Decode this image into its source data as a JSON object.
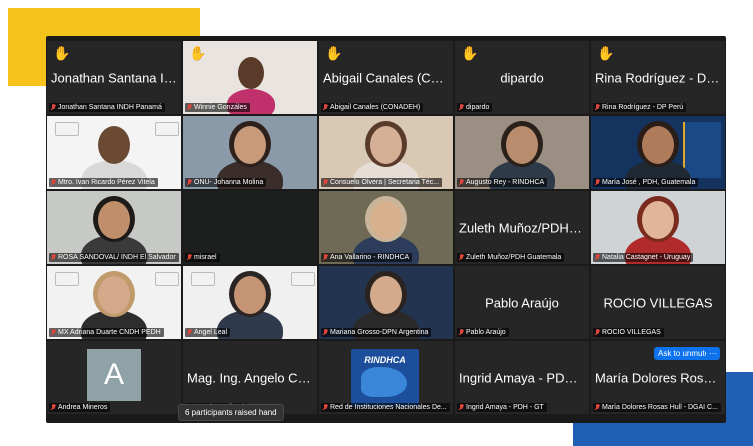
{
  "colors": {
    "accent_yellow": "#f6c21c",
    "accent_blue": "#1f5fb4",
    "tile_bg": "#262626",
    "active_outline": "#2ecc40",
    "mute_red": "#e0453a",
    "zoom_blue": "#0e72ed"
  },
  "tiles": [
    {
      "center": "Jonathan Santana IND...",
      "label": "Jonathan Santana INDH Panamá",
      "hand": true
    },
    {
      "center": "",
      "label": "Winnie Gonzáles",
      "hand": true,
      "active": true
    },
    {
      "center": "Abigail Canales (CON...",
      "label": "Abigail Canales (CONADEH)",
      "hand": true
    },
    {
      "center": "dipardo",
      "label": "dipardo",
      "hand": true
    },
    {
      "center": "Rina Rodríguez - DP P...",
      "label": "Rina Rodríguez - DP Perú",
      "hand": true
    },
    {
      "center": "",
      "label": "Mtro. Ivan Ricardo Pérez Vitela"
    },
    {
      "center": "",
      "label": "ONU- Johanna Molina"
    },
    {
      "center": "",
      "label": "Consuelo Olvera | Secretaria Téc..."
    },
    {
      "center": "",
      "label": "Augusto Rey - RINDHCA"
    },
    {
      "center": "",
      "label": "María José , PDH, Guatemala"
    },
    {
      "center": "",
      "label": "ROSA SANDOVAL/ INDH El Salvador"
    },
    {
      "center": "",
      "label": "misrael"
    },
    {
      "center": "",
      "label": "Ana Vallarino - RINDHCA"
    },
    {
      "center": "Zuleth Muñoz/PDH Gu...",
      "label": "Zuleth Muñoz/PDH Guatemala"
    },
    {
      "center": "",
      "label": "Natalia Castagnet - Uruguay"
    },
    {
      "center": "",
      "label": "MX Adriana Duarte CNDH PEDH"
    },
    {
      "center": "",
      "label": "Angel Leal"
    },
    {
      "center": "",
      "label": "Mariana Grosso-DPN Argentina"
    },
    {
      "center": "Pablo Araújo",
      "label": "Pablo Araújo"
    },
    {
      "center": "ROCIO VILLEGAS",
      "label": "ROCIO VILLEGAS"
    },
    {
      "center": "",
      "label": "Andrea Mineros",
      "avatar": "A"
    },
    {
      "center": "Mag. Ing. Angelo Carib...",
      "label": "Angelo Cariboni"
    },
    {
      "center": "",
      "label": "Red de Instituciones Nacionales De...",
      "logo": "RINDHCA"
    },
    {
      "center": "Ingrid Amaya - PDH -...",
      "label": "Ingrid Amaya - PDH - GT"
    },
    {
      "center": "María Dolores Rosas H...",
      "label": "María Dolores Rosas Hull - DGAI C..."
    }
  ],
  "toast": "6 participants raised hand",
  "ask_unmute": "Ask to unmute",
  "more_glyph": "···"
}
